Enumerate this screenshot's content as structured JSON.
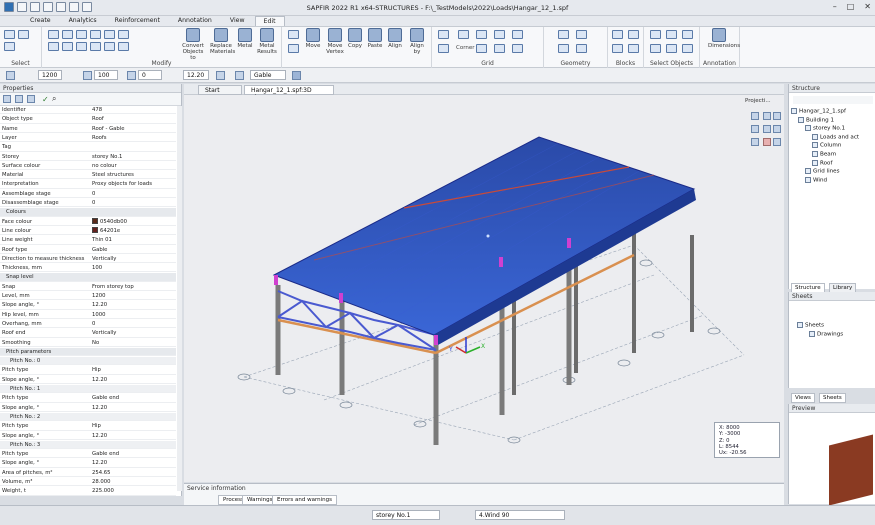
{
  "app": {
    "title": "SAPFIR 2022 R1 x64-STRUCTURES - F:\\_TestModels\\2022\\Loads\\Hangar_12_1.spf"
  },
  "ribbon_tabs": [
    "Create",
    "Analytics",
    "Reinforcement",
    "Annotation",
    "View",
    "Edit"
  ],
  "ribbon": {
    "select": "Select",
    "convert": "Convert Objects to",
    "replace": "Replace Materials",
    "metal": "Metal",
    "metal_results": "Metal Results",
    "modify": "Modify",
    "move": "Move",
    "move_vertex": "Move Vertex",
    "copy": "Copy",
    "paste": "Paste",
    "align": "Align",
    "align_by": "Align by",
    "grid": "Grid",
    "corner": "Corner",
    "geometry": "Geometry",
    "blocks": "Blocks",
    "select_objects": "Select Objects",
    "dimensions": "Dimensions",
    "annotation": "Annotation"
  },
  "toolbar": {
    "f1": "1200",
    "f2": "100",
    "f3": "0",
    "f4": "12.20",
    "roof_type": "Gable"
  },
  "properties": {
    "title": "Properties",
    "rows": [
      {
        "k": "Identifier",
        "v": "478"
      },
      {
        "k": "Object type",
        "v": "Roof"
      },
      {
        "k": "Name",
        "v": "Roof - Gable"
      },
      {
        "k": "Layer",
        "v": "Roofs"
      },
      {
        "k": "Tag",
        "v": ""
      },
      {
        "k": "Storey",
        "v": "storey No.1"
      },
      {
        "k": "Surface colour",
        "v": "no colour"
      },
      {
        "k": "Material",
        "v": "Steel structures"
      },
      {
        "k": "Interpretation",
        "v": "Proxy objects for loads"
      },
      {
        "k": "Assemblage stage",
        "v": "0"
      },
      {
        "k": "Disassemblage stage",
        "v": "0"
      },
      {
        "k": "Colours",
        "v": "",
        "sec": true
      },
      {
        "k": "Face colour",
        "v": "0540db00",
        "sw": "#5a2a1a"
      },
      {
        "k": "Line colour",
        "v": "64201e",
        "sw": "#64201e"
      },
      {
        "k": "Line weight",
        "v": "Thin 01"
      },
      {
        "k": "Roof type",
        "v": "Gable"
      },
      {
        "k": "Direction to measure thickness",
        "v": "Vertically"
      },
      {
        "k": "Thickness, mm",
        "v": "100"
      },
      {
        "k": "Snap level",
        "v": "",
        "sec": true
      },
      {
        "k": "Snap",
        "v": "From storey top"
      },
      {
        "k": "Level, mm",
        "v": "1200"
      },
      {
        "k": "Slope angle, °",
        "v": "12.20"
      },
      {
        "k": "Hip level, mm",
        "v": "1000"
      },
      {
        "k": "Overhang, mm",
        "v": "0"
      },
      {
        "k": "Roof end",
        "v": "Vertically"
      },
      {
        "k": "Smoothing",
        "v": "No"
      },
      {
        "k": "Pitch parameters",
        "v": "",
        "sec": true
      },
      {
        "k": "Pitch No.: 0",
        "v": "",
        "sub": true
      },
      {
        "k": "Pitch type",
        "v": "Hip"
      },
      {
        "k": "Slope angle, °",
        "v": "12.20"
      },
      {
        "k": "Pitch No.: 1",
        "v": "",
        "sub": true
      },
      {
        "k": "Pitch type",
        "v": "Gable end"
      },
      {
        "k": "Slope angle, °",
        "v": "12.20"
      },
      {
        "k": "Pitch No.: 2",
        "v": "",
        "sub": true
      },
      {
        "k": "Pitch type",
        "v": "Hip"
      },
      {
        "k": "Slope angle, °",
        "v": "12.20"
      },
      {
        "k": "Pitch No.: 3",
        "v": "",
        "sub": true
      },
      {
        "k": "Pitch type",
        "v": "Gable end"
      },
      {
        "k": "Slope angle, °",
        "v": "12.20"
      },
      {
        "k": "Area of pitches, m²",
        "v": "254.65"
      },
      {
        "k": "Volume, m³",
        "v": "28.000"
      },
      {
        "k": "Weight, t",
        "v": "225.000"
      }
    ]
  },
  "view_tabs": [
    "Start page",
    "Hangar_12_1.spf:3D view"
  ],
  "projects_label": "Projecti...",
  "coords": {
    "x": "X: 8000",
    "y": "Y: -3000",
    "z": "Z: 0",
    "l": "L: 8544",
    "ux": "Ux: -20.56"
  },
  "service": {
    "title": "Service information",
    "tabs": [
      "Process",
      "Warnings",
      "Errors and warnings"
    ]
  },
  "structure": {
    "title": "Structure",
    "nodes": [
      {
        "t": "Hangar_12_1.spf",
        "d": 0
      },
      {
        "t": "Building 1",
        "d": 1
      },
      {
        "t": "storey No.1",
        "d": 2
      },
      {
        "t": "Loads and act",
        "d": 3
      },
      {
        "t": "Column",
        "d": 3
      },
      {
        "t": "Beam",
        "d": 3
      },
      {
        "t": "Roof",
        "d": 3
      },
      {
        "t": "Grid lines",
        "d": 2
      },
      {
        "t": "Wind",
        "d": 2
      }
    ],
    "tabs": [
      "Structure",
      "Library"
    ]
  },
  "sheets": {
    "title": "Sheets",
    "root": "Sheets",
    "child": "Drawings",
    "tabs": [
      "Views",
      "Sheets"
    ]
  },
  "preview": {
    "title": "Preview"
  },
  "statusbar": {
    "storey": "storey No.1",
    "wind": "4.Wind 90"
  }
}
